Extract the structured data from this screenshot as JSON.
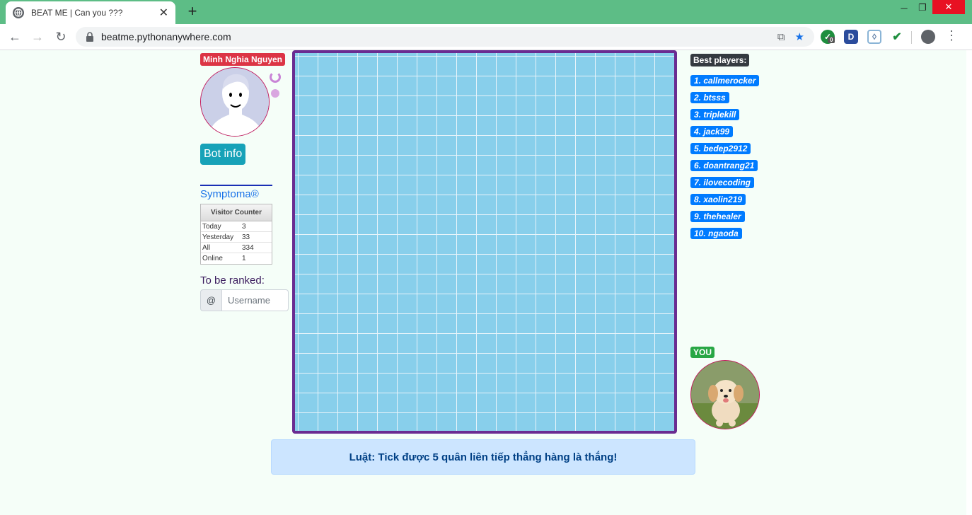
{
  "browser": {
    "tab_title": "BEAT ME | Can you ???",
    "url": "beatme.pythonanywhere.com",
    "ext_badge": "0",
    "ext_d": "D"
  },
  "bot": {
    "name": "Minh Nghia Nguyen",
    "info_button": "Bot info"
  },
  "symptoma": "Symptoma®",
  "visitor_counter": {
    "title": "Visitor Counter",
    "rows": [
      {
        "label": "Today",
        "value": "3"
      },
      {
        "label": "Yesterday",
        "value": "33"
      },
      {
        "label": "All",
        "value": "334"
      },
      {
        "label": "Online",
        "value": "1"
      }
    ]
  },
  "ranking": {
    "label": "To be ranked:",
    "prefix": "@",
    "placeholder": "Username"
  },
  "best_players": {
    "label": "Best players:",
    "items": [
      "1. callmerocker",
      "2. btsss",
      "3. triplekill",
      "4. jack99",
      "5. bedep2912",
      "6. doantrang21",
      "7. ilovecoding",
      "8. xaolin219",
      "9. thehealer",
      "10. ngaoda"
    ]
  },
  "you_label": "YOU",
  "rule": "Luật: Tick được 5 quân liên tiếp thẳng hàng là thắng!",
  "board": {
    "rows": 19,
    "cols": 19
  }
}
